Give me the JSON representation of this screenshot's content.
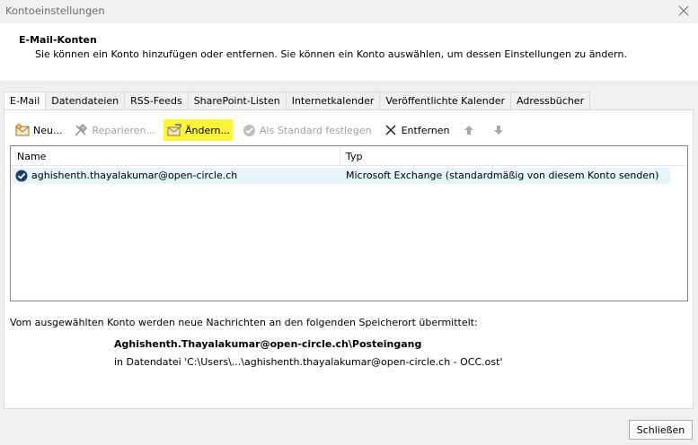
{
  "window": {
    "title": "Kontoeinstellungen"
  },
  "header": {
    "title": "E-Mail-Konten",
    "subtitle": "Sie können ein Konto hinzufügen oder entfernen. Sie können ein Konto auswählen, um dessen Einstellungen zu ändern."
  },
  "tabs": [
    {
      "label": "E-Mail",
      "active": true
    },
    {
      "label": "Datendateien"
    },
    {
      "label": "RSS-Feeds"
    },
    {
      "label": "SharePoint-Listen"
    },
    {
      "label": "Internetkalender"
    },
    {
      "label": "Veröffentlichte Kalender"
    },
    {
      "label": "Adressbücher"
    }
  ],
  "toolbar": {
    "new_label": "Neu...",
    "repair_label": "Reparieren...",
    "change_label": "Ändern...",
    "default_label": "Als Standard festlegen",
    "remove_label": "Entfernen"
  },
  "list": {
    "columns": [
      "Name",
      "Typ"
    ],
    "rows": [
      {
        "name": "aghishenth.thayalakumar@open-circle.ch",
        "type": "Microsoft Exchange (standardmäßig von diesem Konto senden)"
      }
    ]
  },
  "delivery": {
    "info": "Vom ausgewählten Konto werden neue Nachrichten an den folgenden Speicherort übermittelt:",
    "location": "Aghishenth.Thayalakumar@open-circle.ch\\Posteingang",
    "file": "in Datendatei 'C:\\Users\\...\\aghishenth.thayalakumar@open-circle.ch - OCC.ost'"
  },
  "footer": {
    "close_label": "Schließen"
  },
  "colors": {
    "highlight": "#fbf53a",
    "selection": "#e5f3fb",
    "accent": "#1a5ea8"
  }
}
